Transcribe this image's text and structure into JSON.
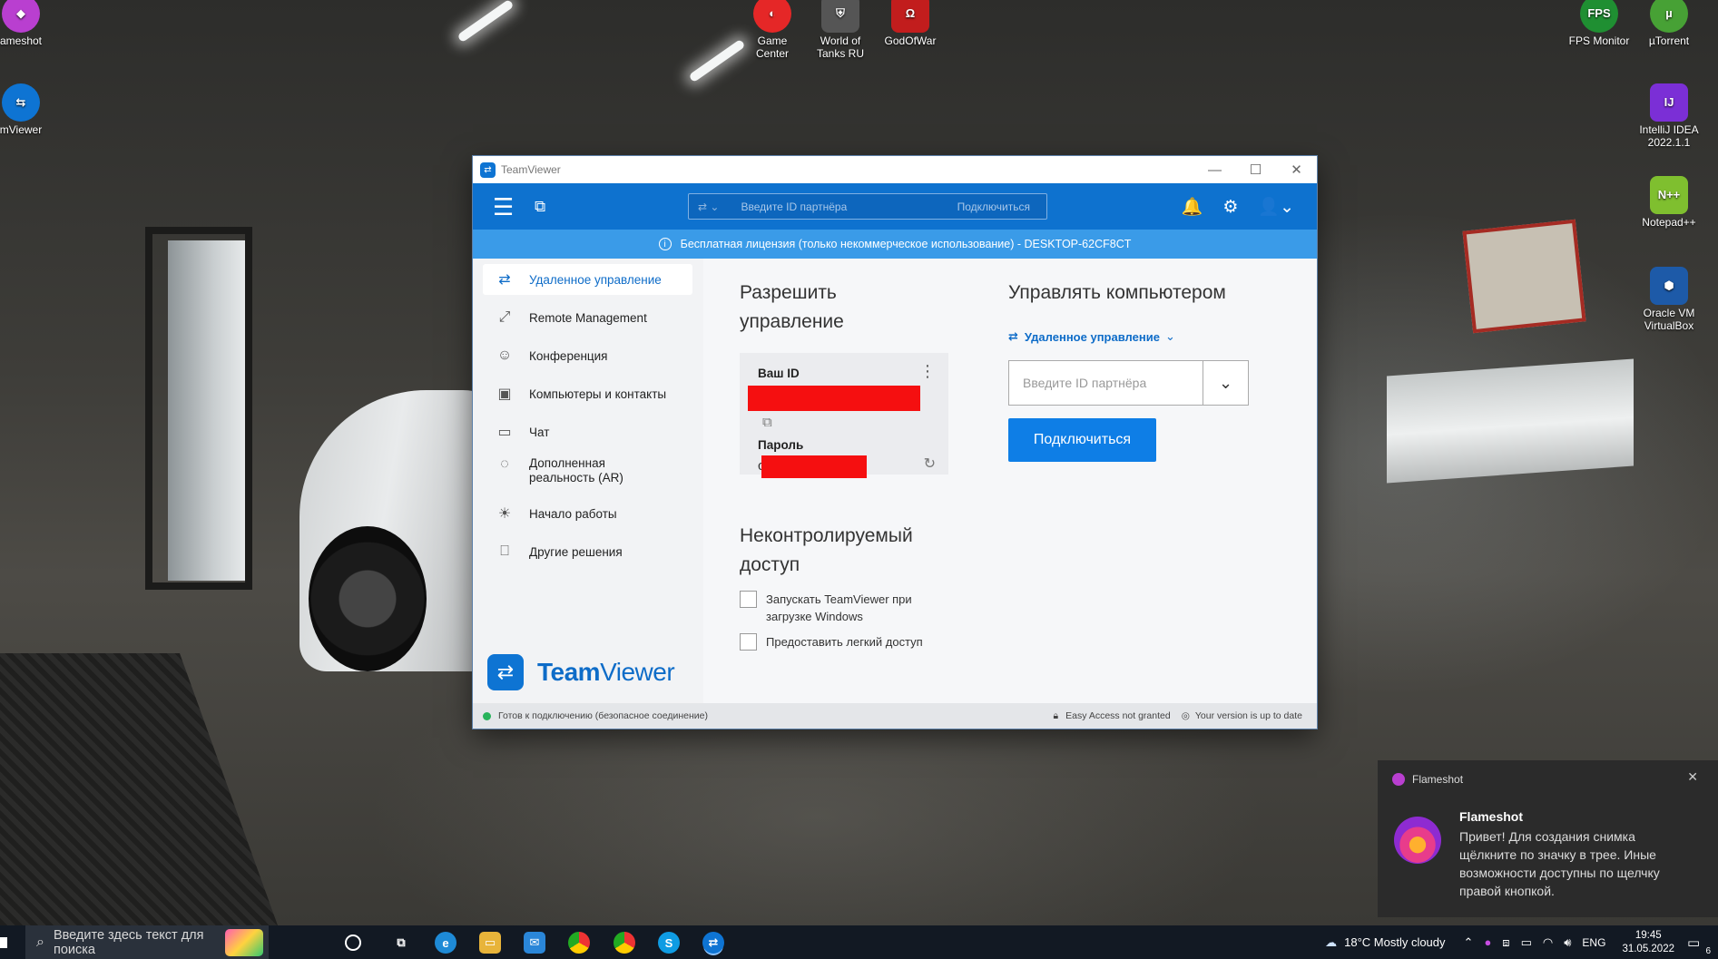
{
  "desktop": {
    "icons": [
      {
        "label": "ameshot",
        "glyph": "◆",
        "color": "#b93fd0"
      },
      {
        "label": "mViewer",
        "glyph": "⇆",
        "color": "#0e74d3"
      },
      {
        "label": "Game Center",
        "glyph": "◐",
        "color": "#e52727"
      },
      {
        "label": "World of Tanks RU",
        "glyph": "⛨",
        "color": "#555"
      },
      {
        "label": "GodOfWar",
        "glyph": "Ω",
        "color": "#c21d1d"
      },
      {
        "label": "FPS Monitor",
        "glyph": "FPS",
        "color": "#1f8f32"
      },
      {
        "label": "µTorrent",
        "glyph": "µ",
        "color": "#47a135"
      },
      {
        "label": "IntelliJ IDEA 2022.1.1",
        "glyph": "IJ",
        "color": "#7b2fd6"
      },
      {
        "label": "Notepad++",
        "glyph": "N++",
        "color": "#7fbf2f"
      },
      {
        "label": "Oracle VM VirtualBox",
        "glyph": "⬢",
        "color": "#1d5aa8"
      }
    ]
  },
  "window": {
    "title": "TeamViewer",
    "controls": {
      "minimize": "—",
      "maximize": "☐",
      "close": "✕"
    },
    "toolbar": {
      "menu_glyph": "☰",
      "monitor_glyph": "⧉",
      "partner_placeholder": "Введите ID партнёра",
      "connect_label": "Подключиться",
      "bell_glyph": "🔔",
      "gear_glyph": "⚙",
      "user_glyph": "👤⌄"
    },
    "license_banner": "Бесплатная лицензия (только некоммерческое использование) - DESKTOP-62CF8CT",
    "sidebar": {
      "items": [
        {
          "label": "Удаленное управление",
          "glyph": "⇄"
        },
        {
          "label": "Remote Management",
          "glyph": "⤢"
        },
        {
          "label": "Конференция",
          "glyph": "☺"
        },
        {
          "label": "Компьютеры и контакты",
          "glyph": "▣"
        },
        {
          "label": "Чат",
          "glyph": "▭"
        },
        {
          "label": "Дополненная реальность (AR)",
          "glyph": "◌"
        },
        {
          "label": "Начало работы",
          "glyph": "☀"
        },
        {
          "label": "Другие решения",
          "glyph": "⎕"
        }
      ],
      "brand_a": "Team",
      "brand_b": "Viewer"
    },
    "allow": {
      "heading": "Разрешить управление",
      "your_id_label": "Ваш ID",
      "password_label": "Пароль",
      "password_prefix": "с",
      "more_glyph": "⋮",
      "copy_glyph": "⧉",
      "refresh_glyph": "↻"
    },
    "unattended": {
      "heading": "Неконтролируемый доступ",
      "option1": "Запускать TeamViewer при загрузке Windows",
      "option2": "Предоставить легкий доступ"
    },
    "control": {
      "heading": "Управлять компьютером",
      "mode_label": "Удаленное управление",
      "partner_placeholder": "Введите ID партнёра",
      "connect_button": "Подключиться"
    },
    "status": {
      "ready": "Готов к подключению (безопасное соединение)",
      "easy_access": "Easy Access not granted",
      "version": "Your version is up to date"
    }
  },
  "toast": {
    "app": "Flameshot",
    "title": "Flameshot",
    "message": "Привет! Для создания снимка щёлкните по значку в трее. Иные возможности доступны по щелчку правой кнопкой.",
    "close": "✕"
  },
  "taskbar": {
    "search_placeholder": "Введите здесь текст для поиска",
    "weather": "18°C  Mostly cloudy",
    "lang": "ENG",
    "time": "19:45",
    "date": "31.05.2022",
    "notif_count": "6"
  }
}
